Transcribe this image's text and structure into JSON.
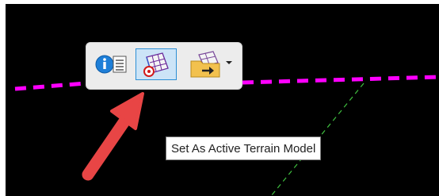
{
  "tooltip": {
    "text": "Set As Active Terrain Model"
  },
  "toolbar": {
    "buttons": [
      {
        "name": "properties",
        "icon": "info-list-icon",
        "state": "normal"
      },
      {
        "name": "set-as-active-terrain-model",
        "icon": "terrain-model-target-icon",
        "state": "hovered"
      },
      {
        "name": "terrain-model-open",
        "icon": "terrain-folder-arrow-icon",
        "state": "normal",
        "has_dropdown": true
      }
    ]
  },
  "colors": {
    "viewport_background": "#000000",
    "dashed_line_magenta": "#ff00ff",
    "dashed_line_green": "#3fbf3f",
    "toolbar_background": "#ececec",
    "active_button_fill": "#cce4f7",
    "active_button_border": "#2d8fd5",
    "annotation_arrow": "#e84545",
    "tooltip_border": "#767676"
  }
}
